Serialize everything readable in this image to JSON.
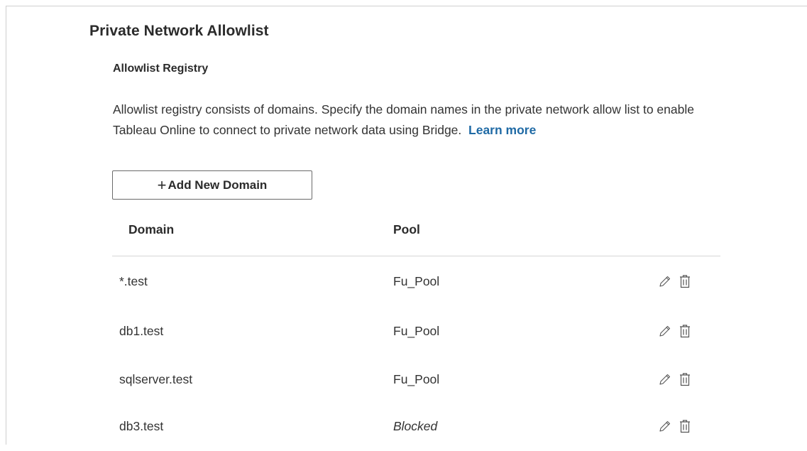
{
  "page": {
    "title": "Private Network Allowlist",
    "subtitle": "Allowlist Registry",
    "description": "Allowlist registry consists of domains. Specify the domain names in the private network allow list to enable Tableau Online to connect to private network data using Bridge.",
    "learn_more": "Learn more"
  },
  "toolbar": {
    "add_icon": "+",
    "add_label": "Add New Domain"
  },
  "table": {
    "columns": [
      "Domain",
      "Pool"
    ],
    "rows": [
      {
        "domain": "*.test",
        "pool": "Fu_Pool",
        "edit_icon": "pencil-icon",
        "delete_icon": "trash-icon"
      },
      {
        "domain": "db1.test",
        "pool": "Fu_Pool",
        "edit_icon": "pencil-icon",
        "delete_icon": "trash-icon"
      },
      {
        "domain": "sqlserver.test",
        "pool": "Fu_Pool",
        "edit_icon": "pencil-icon",
        "delete_icon": "trash-icon"
      },
      {
        "domain": "db3.test",
        "pool": "Blocked",
        "edit_icon": "pencil-icon",
        "delete_icon": "trash-icon"
      }
    ]
  },
  "colors": {
    "link": "#1f6aa5",
    "text": "#333333",
    "border": "#cfcfcf"
  }
}
